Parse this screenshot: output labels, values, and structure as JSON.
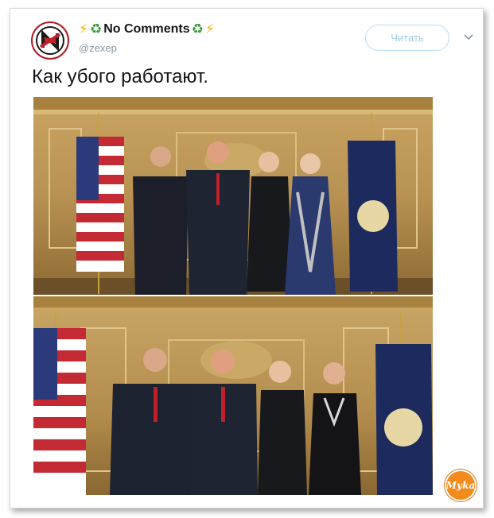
{
  "tweet": {
    "display_name": "No Comments",
    "name_emoji": {
      "left_bolt": "⚡",
      "left_recycle": "♻",
      "right_recycle": "♻",
      "right_bolt": "⚡"
    },
    "handle": "@zexep",
    "follow_label": "Читать",
    "text": "Как убого работают."
  },
  "watermark": {
    "text": "Муka"
  },
  "colors": {
    "follow_border": "#b9dcf3",
    "follow_text": "#9fcbe8",
    "handle": "#8899a6",
    "bolt": "#f5b400",
    "recycle": "#3a9a3a",
    "avatar_ring": "#b01b24",
    "watermark": "#f28a1c"
  },
  "icons": {
    "avatar": "avatar-logo",
    "menu": "chevron-down-icon"
  }
}
